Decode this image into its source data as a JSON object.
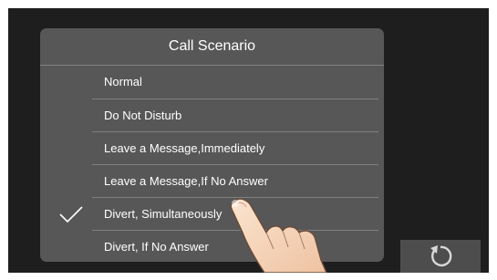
{
  "dialog": {
    "title": "Call Scenario",
    "options": [
      {
        "label": "Normal",
        "selected": false
      },
      {
        "label": "Do Not Disturb",
        "selected": false
      },
      {
        "label": "Leave a Message,Immediately",
        "selected": false
      },
      {
        "label": "Leave a Message,If No Answer",
        "selected": false
      },
      {
        "label": "Divert, Simultaneously",
        "selected": true
      },
      {
        "label": "Divert, If No Answer",
        "selected": false
      }
    ]
  },
  "icons": {
    "check": "checkmark-icon",
    "back": "refresh-back-icon",
    "pointer": "hand-pointer-icon"
  },
  "colors": {
    "screen": "#1e1e1e",
    "dialog": "#575757",
    "divider": "#808080",
    "text": "#ffffff"
  }
}
